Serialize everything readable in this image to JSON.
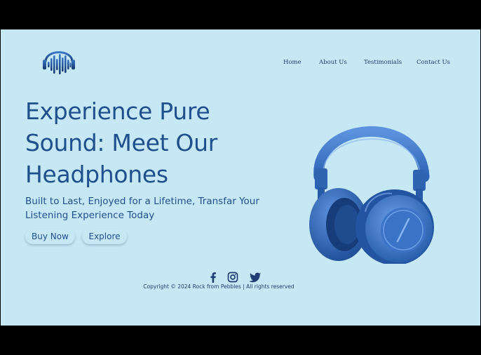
{
  "nav": {
    "items": [
      {
        "label": "Home"
      },
      {
        "label": "About Us"
      },
      {
        "label": "Testimonials"
      },
      {
        "label": "Contact Us"
      }
    ]
  },
  "hero": {
    "title_lines": [
      "Experience Pure",
      "Sound: Meet Our",
      "Headphones"
    ],
    "subtitle_lines": [
      "Built to Last, Enjoyed for a Lifetime, Transfar Your",
      "Listening Experience Today"
    ],
    "buttons": {
      "buy": "Buy Now",
      "explore": "Explore"
    }
  },
  "footer": {
    "social_icons": [
      "facebook-icon",
      "instagram-icon",
      "twitter-icon"
    ],
    "copyright": "Copyright © 2024 Rock from Pebbles | All rights reserved"
  },
  "colors": {
    "background": "#c6e8f4",
    "text_primary": "#1f4f8c",
    "nav_text": "#1f3f72",
    "frame": "#000000"
  }
}
